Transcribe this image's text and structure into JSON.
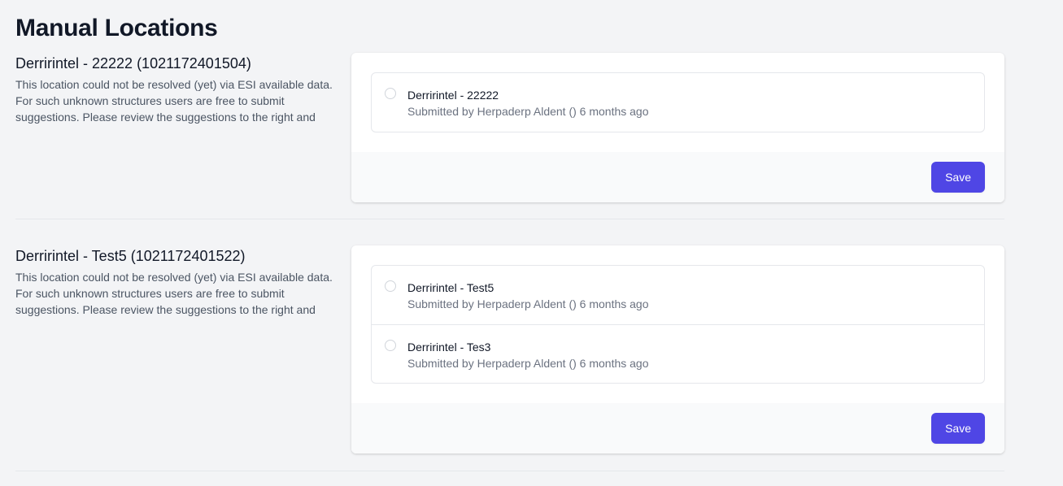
{
  "page": {
    "title": "Manual Locations"
  },
  "sections": [
    {
      "heading": "Derririntel - 22222 (1021172401504)",
      "description": "This location could not be resolved (yet) via ESI available data. For such unknown structures users are free to submit suggestions. Please review the suggestions to the right and",
      "options": [
        {
          "label": "Derririntel - 22222",
          "meta": "Submitted by Herpaderp Aldent () 6 months ago",
          "selected": false
        }
      ],
      "save_label": "Save"
    },
    {
      "heading": "Derririntel - Test5 (1021172401522)",
      "description": "This location could not be resolved (yet) via ESI available data. For such unknown structures users are free to submit suggestions. Please review the suggestions to the right and",
      "options": [
        {
          "label": "Derririntel - Test5",
          "meta": "Submitted by Herpaderp Aldent () 6 months ago",
          "selected": false
        },
        {
          "label": "Derririntel - Tes3",
          "meta": "Submitted by Herpaderp Aldent () 6 months ago",
          "selected": false
        }
      ],
      "save_label": "Save"
    }
  ],
  "colors": {
    "accent": "#4f46e5",
    "background": "#f3f4f6",
    "card": "#ffffff",
    "card_footer": "#f9fafb",
    "border": "#e5e7eb"
  }
}
